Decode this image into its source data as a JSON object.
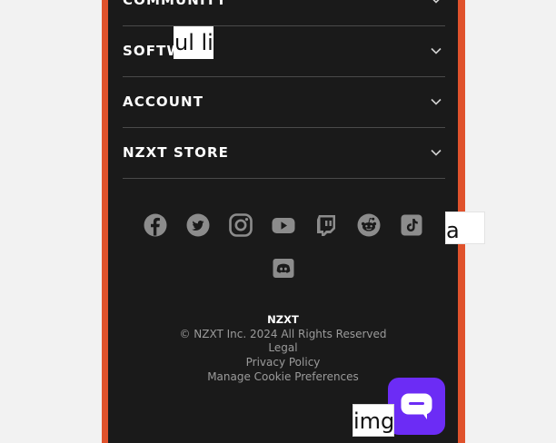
{
  "menu": {
    "items": [
      {
        "label": "COMMUNITY"
      },
      {
        "label": "SOFTWARE"
      },
      {
        "label": "ACCOUNT"
      },
      {
        "label": "NZXT STORE"
      }
    ]
  },
  "social": {
    "icons": [
      "facebook-icon",
      "twitter-icon",
      "instagram-icon",
      "youtube-icon",
      "twitch-icon",
      "reddit-icon",
      "tiktok-icon",
      "discord-icon"
    ]
  },
  "footer": {
    "brand": "NZXT",
    "copyright": "© NZXT Inc. 2024 All Rights Reserved",
    "legal": "Legal",
    "privacy": "Privacy Policy",
    "cookies": "Manage Cookie Preferences"
  },
  "placeholders": {
    "ul_li": "ul li",
    "a": "a",
    "img": "img"
  },
  "colors": {
    "accent": "#e0522c",
    "panel": "#1a1a1a",
    "chat": "#6c2cf5",
    "icon": "#8c8c8c"
  }
}
